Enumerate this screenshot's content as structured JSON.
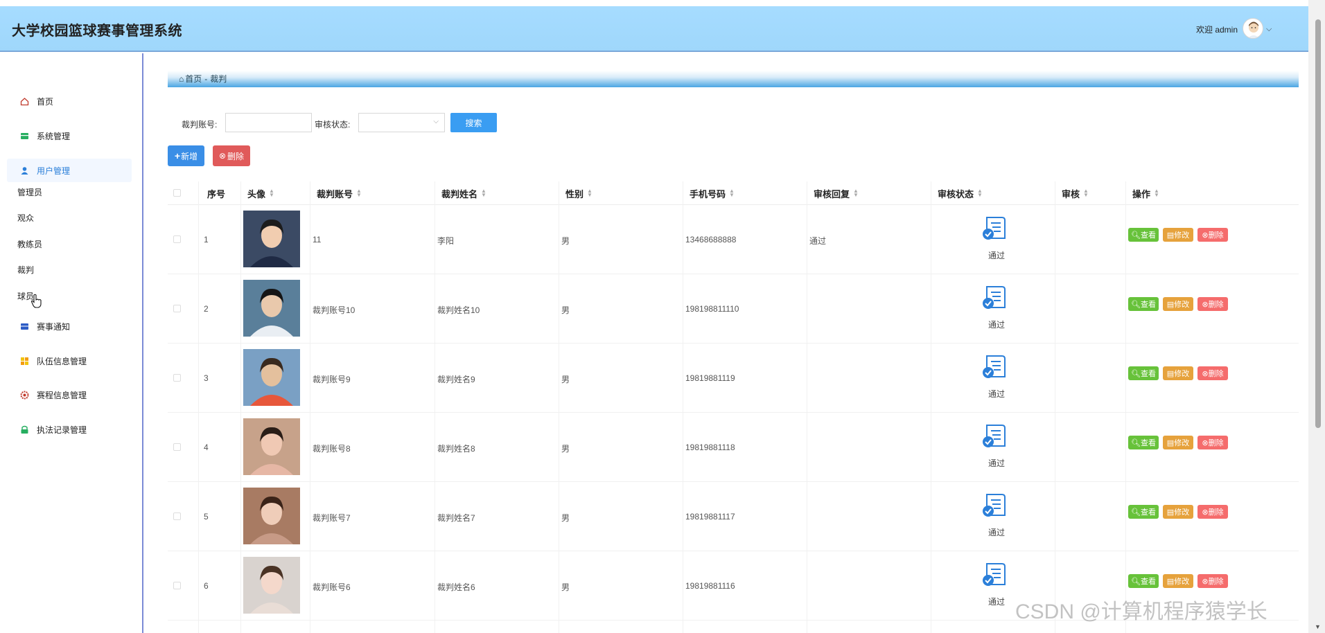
{
  "header": {
    "title": "大学校园篮球赛事管理系统",
    "welcome": "欢迎 admin",
    "dropdown_caret": "⌵"
  },
  "sidebar": {
    "items": [
      {
        "label": "首页",
        "icon": "home-icon"
      },
      {
        "label": "系统管理",
        "icon": "system-icon"
      },
      {
        "label": "用户管理",
        "icon": "user-icon"
      },
      {
        "label": "赛事通知",
        "icon": "notice-icon"
      },
      {
        "label": "队伍信息管理",
        "icon": "team-icon"
      },
      {
        "label": "赛程信息管理",
        "icon": "schedule-icon"
      },
      {
        "label": "执法记录管理",
        "icon": "record-icon"
      }
    ],
    "sub_items": [
      "管理员",
      "观众",
      "教练员",
      "裁判",
      "球员"
    ]
  },
  "breadcrumb": {
    "home": "首页",
    "separator": "-",
    "current": "裁判"
  },
  "search": {
    "account_label": "裁判账号:",
    "account_value": "",
    "status_label": "审核状态:",
    "status_value": "",
    "search_button": "搜索"
  },
  "actions": {
    "add": "新增",
    "delete": "删除"
  },
  "table": {
    "headers": [
      "序号",
      "头像",
      "裁判账号",
      "裁判姓名",
      "性别",
      "手机号码",
      "审核回复",
      "审核状态",
      "审核",
      "操作"
    ],
    "op_view": "查看",
    "op_edit": "修改",
    "op_delete": "删除",
    "rows": [
      {
        "index": "1",
        "account": "11",
        "name": "李阳",
        "gender": "男",
        "phone": "13468688888",
        "reply": "通过",
        "status": "通过"
      },
      {
        "index": "2",
        "account": "裁判账号10",
        "name": "裁判姓名10",
        "gender": "男",
        "phone": "198198811110",
        "reply": "",
        "status": "通过"
      },
      {
        "index": "3",
        "account": "裁判账号9",
        "name": "裁判姓名9",
        "gender": "男",
        "phone": "19819881119",
        "reply": "",
        "status": "通过"
      },
      {
        "index": "4",
        "account": "裁判账号8",
        "name": "裁判姓名8",
        "gender": "男",
        "phone": "19819881118",
        "reply": "",
        "status": "通过"
      },
      {
        "index": "5",
        "account": "裁判账号7",
        "name": "裁判姓名7",
        "gender": "男",
        "phone": "19819881117",
        "reply": "",
        "status": "通过"
      },
      {
        "index": "6",
        "account": "裁判账号6",
        "name": "裁判姓名6",
        "gender": "男",
        "phone": "19819881116",
        "reply": "",
        "status": "通过"
      }
    ]
  },
  "watermark": "CSDN @计算机程序猿学长",
  "colors": {
    "header_bg": "#a6dcff",
    "primary": "#3a9df2",
    "view": "#67c23a",
    "edit": "#e6a23c",
    "delete": "#f56c6c"
  }
}
